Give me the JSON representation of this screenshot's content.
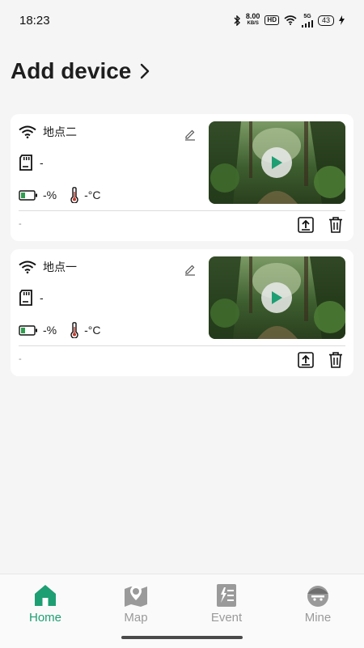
{
  "status_bar": {
    "time": "18:23",
    "net_speed_value": "8.00",
    "net_speed_unit": "KB/S",
    "hd_label": "HD",
    "network_type": "5G",
    "battery_level": "43"
  },
  "header": {
    "title": "Add device"
  },
  "devices": [
    {
      "name": "地点二",
      "sd_value": "-",
      "battery": "-%",
      "temperature": "-°C",
      "footer_text": "-"
    },
    {
      "name": "地点一",
      "sd_value": "-",
      "battery": "-%",
      "temperature": "-°C",
      "footer_text": "-"
    }
  ],
  "tabs": [
    {
      "label": "Home",
      "icon": "home-icon",
      "active": true
    },
    {
      "label": "Map",
      "icon": "map-pin-icon",
      "active": false
    },
    {
      "label": "Event",
      "icon": "event-list-icon",
      "active": false
    },
    {
      "label": "Mine",
      "icon": "user-avatar-icon",
      "active": false
    }
  ],
  "colors": {
    "accent": "#1e9e73",
    "inactive": "#9a9a9a"
  }
}
